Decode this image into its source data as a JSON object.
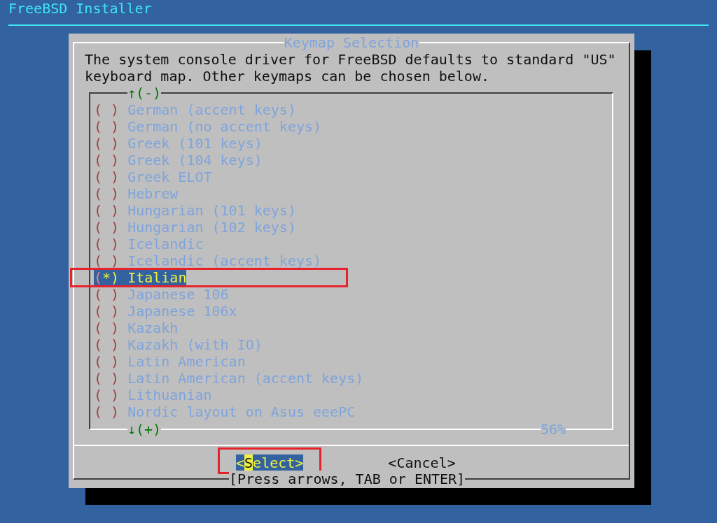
{
  "header": {
    "title": "FreeBSD Installer"
  },
  "dialog": {
    "title": "Keymap Selection",
    "message": [
      "The system console driver for FreeBSD defaults to standard \"US\"",
      "keyboard map. Other keymaps can be chosen below."
    ],
    "list": {
      "scroll_up": "↑(-)",
      "scroll_down": "↓(+)",
      "percent": "56%",
      "radio_empty": [
        "(",
        ")"
      ],
      "radio_checked": [
        "(",
        "*",
        ")"
      ],
      "items": [
        {
          "label": "German (accent keys)",
          "selected": false,
          "annotated": false
        },
        {
          "label": "German (no accent keys)",
          "selected": false,
          "annotated": false
        },
        {
          "label": "Greek (101 keys)",
          "selected": false,
          "annotated": false
        },
        {
          "label": "Greek (104 keys)",
          "selected": false,
          "annotated": false
        },
        {
          "label": "Greek ELOT",
          "selected": false,
          "annotated": false
        },
        {
          "label": "Hebrew",
          "selected": false,
          "annotated": false
        },
        {
          "label": "Hungarian (101 keys)",
          "selected": false,
          "annotated": false
        },
        {
          "label": "Hungarian (102 keys)",
          "selected": false,
          "annotated": false
        },
        {
          "label": "Icelandic",
          "selected": false,
          "annotated": false
        },
        {
          "label": "Icelandic (accent keys)",
          "selected": false,
          "annotated": false
        },
        {
          "label": "Italian",
          "selected": true,
          "annotated": true
        },
        {
          "label": "Japanese 106",
          "selected": false,
          "annotated": false
        },
        {
          "label": "Japanese 106x",
          "selected": false,
          "annotated": false
        },
        {
          "label": "Kazakh",
          "selected": false,
          "annotated": false
        },
        {
          "label": "Kazakh (with IO)",
          "selected": false,
          "annotated": false
        },
        {
          "label": "Latin American",
          "selected": false,
          "annotated": false
        },
        {
          "label": "Latin American (accent keys)",
          "selected": false,
          "annotated": false
        },
        {
          "label": "Lithuanian",
          "selected": false,
          "annotated": false
        },
        {
          "label": "Nordic layout on Asus eeePC",
          "selected": false,
          "annotated": false
        }
      ]
    },
    "buttons": [
      {
        "label": "<Select>",
        "selected": true,
        "annotated": true
      },
      {
        "label": "<Cancel>",
        "selected": false,
        "annotated": false
      }
    ],
    "hint": "[Press arrows, TAB or ENTER]"
  }
}
